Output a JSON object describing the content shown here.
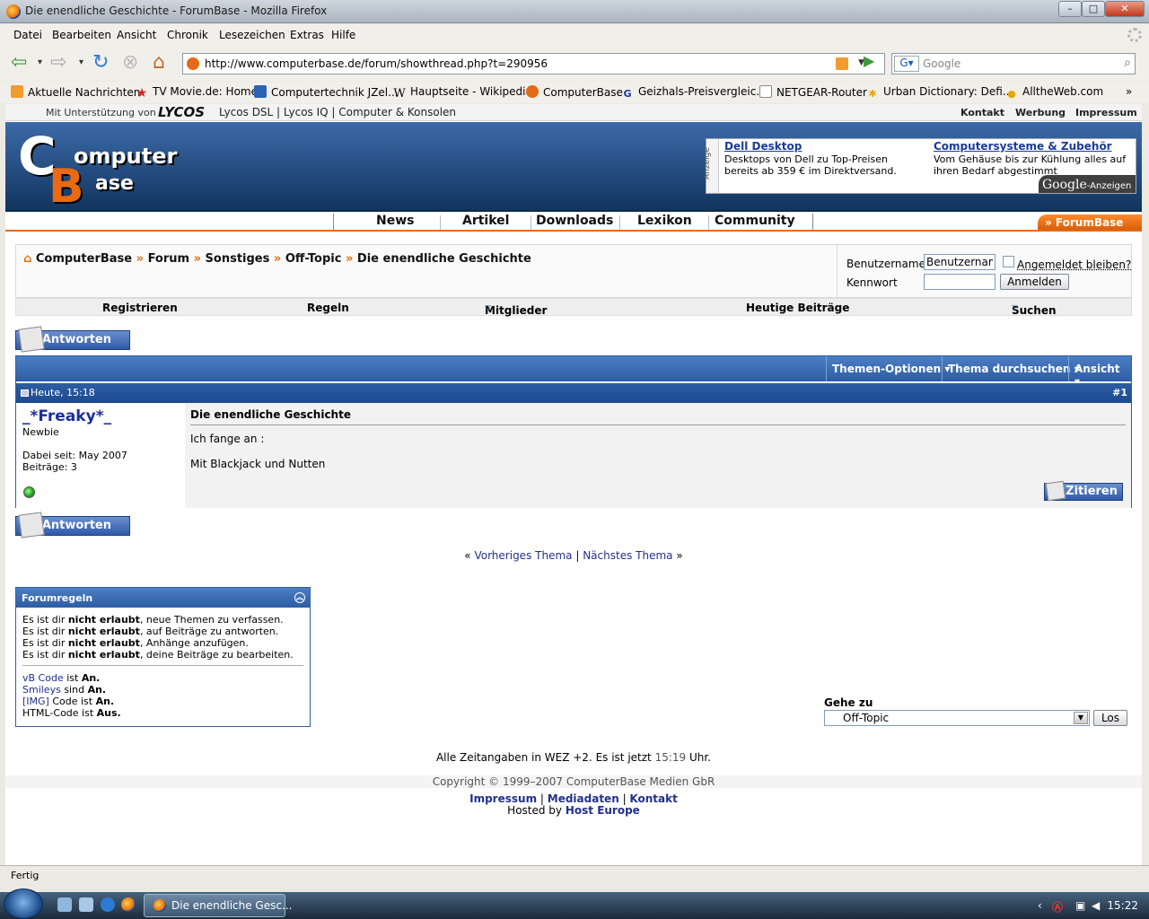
{
  "window": {
    "title": "Die enendliche Geschichte - ForumBase - Mozilla Firefox"
  },
  "menu": [
    "Datei",
    "Bearbeiten",
    "Ansicht",
    "Chronik",
    "Lesezeichen",
    "Extras",
    "Hilfe"
  ],
  "address": {
    "url": "http://www.computerbase.de/forum/showthread.php?t=290956"
  },
  "search": {
    "placeholder": "Google"
  },
  "bookmarks": [
    "Aktuelle Nachrichten",
    "TV Movie.de: Home",
    "Computertechnik JZel...",
    "Hauptseite - Wikipedia",
    "ComputerBase",
    "Geizhals-Preisvergleic...",
    "NETGEAR-Router",
    "Urban Dictionary: Defi...",
    "AlltheWeb.com"
  ],
  "lycos": {
    "prefix": "Mit Unterstützung von",
    "logo": "LYCOS",
    "links": "Lycos DSL | Lycos IQ | Computer & Konsolen",
    "right": [
      "Kontakt",
      "Werbung",
      "Impressum"
    ]
  },
  "logo": {
    "text": "ComputerBase"
  },
  "ad": {
    "label": "Anzeige",
    "items": [
      {
        "title": "Dell Desktop",
        "line1": "Desktops von Dell zu Top-Preisen",
        "line2": "bereits ab 359 € im Direktversand."
      },
      {
        "title": "Computersysteme & Zubehör",
        "line1": "Vom Gehäuse bis zur Kühlung alles auf",
        "line2": "ihren Bedarf abgestimmt"
      }
    ],
    "google": "Google",
    "google_suffix": "-Anzeigen"
  },
  "nav_tabs": [
    "News",
    "Artikel",
    "Downloads",
    "Lexikon",
    "Community"
  ],
  "forumbase_tab": "» ForumBase",
  "breadcrumb": {
    "items": [
      "ComputerBase",
      "Forum",
      "Sonstiges",
      "Off-Topic",
      "Die enendliche Geschichte"
    ],
    "sep": "»"
  },
  "login": {
    "user_label": "Benutzername",
    "user_value": "Benutzernam",
    "pass_label": "Kennwort",
    "remember": "Angemeldet bleiben?",
    "button": "Anmelden"
  },
  "subnav": [
    "Registrieren",
    "Regeln",
    "Mitglieder",
    "Heutige Beiträge",
    "Suchen"
  ],
  "reply_button": "Antworten",
  "thread_options": [
    "Themen-Optionen",
    "Thema durchsuchen",
    "Ansicht"
  ],
  "post": {
    "date": "Heute, 15:18",
    "number": "#1",
    "user": "_*Freaky*_",
    "rank": "Newbie",
    "joined": "Dabei seit: May 2007",
    "posts": "Beiträge: 3",
    "title": "Die enendliche Geschichte",
    "line1": "Ich fange an :",
    "line2": "Mit Blackjack und Nutten",
    "quote_button": "Zitieren"
  },
  "prevnext": {
    "left": "«",
    "prev": "Vorheriges Thema",
    "sep": "|",
    "next": "Nächstes Thema",
    "right": "»"
  },
  "rules": {
    "title": "Forumregeln",
    "lines": [
      [
        "Es ist dir ",
        "nicht erlaubt",
        ", neue Themen zu verfassen."
      ],
      [
        "Es ist dir ",
        "nicht erlaubt",
        ", auf Beiträge zu antworten."
      ],
      [
        "Es ist dir ",
        "nicht erlaubt",
        ", Anhänge anzufügen."
      ],
      [
        "Es ist dir ",
        "nicht erlaubt",
        ", deine Beiträge zu bearbeiten."
      ]
    ],
    "codes": [
      [
        "vB Code",
        " ist ",
        "An."
      ],
      [
        "Smileys",
        " sind ",
        "An."
      ],
      [
        "[IMG]",
        " Code ist ",
        "An."
      ],
      [
        "",
        "HTML-Code ist ",
        "Aus."
      ]
    ]
  },
  "goto": {
    "label": "Gehe zu",
    "value": "Off-Topic",
    "button": "Los"
  },
  "timezone": {
    "text": "Alle Zeitangaben in WEZ +2. Es ist jetzt ",
    "time": "15:19",
    "suffix": " Uhr."
  },
  "copyright": "Copyright © 1999–2007 ComputerBase Medien GbR",
  "footer": {
    "links": [
      "Impressum",
      "Mediadaten",
      "Kontakt"
    ],
    "hosted": "Hosted by ",
    "host": "Host Europe"
  },
  "status": "Fertig",
  "taskbar": {
    "task": "Die enendliche Gesc...",
    "clock": "15:22"
  }
}
